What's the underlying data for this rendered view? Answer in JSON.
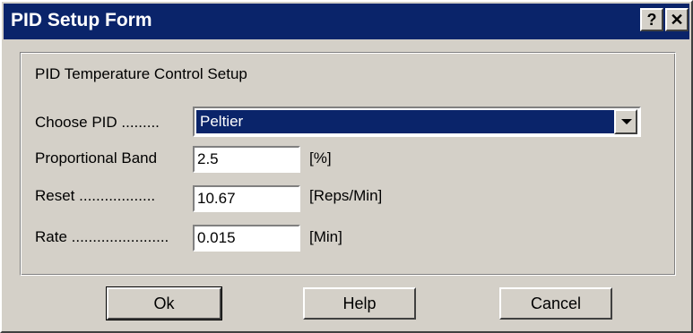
{
  "window": {
    "title": "PID Setup Form",
    "help_glyph": "?",
    "close_glyph": "✕"
  },
  "group": {
    "title": "PID Temperature Control Setup",
    "choose_pid_label": "Choose PID .........",
    "choose_pid_value": "Peltier",
    "proportional_label": "Proportional Band",
    "proportional_value": "2.5",
    "proportional_unit": "[%]",
    "reset_label": "Reset ..................",
    "reset_value": "10.67",
    "reset_unit": "[Reps/Min]",
    "rate_label": "Rate .......................",
    "rate_value": "0.015",
    "rate_unit": "[Min]"
  },
  "buttons": {
    "ok": "Ok",
    "help": "Help",
    "cancel": "Cancel"
  },
  "colors": {
    "titlebar": "#0a246a",
    "face": "#d4d0c8",
    "selection": "#0a246a"
  }
}
